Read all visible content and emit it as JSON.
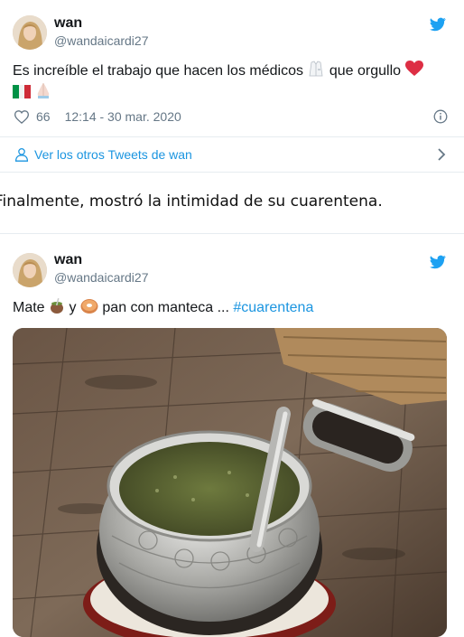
{
  "tweet1": {
    "name": "wan",
    "handle": "@wandaicardi27",
    "text": "Es increíble el trabajo que hacen los médicos",
    "text2": "que orgullo",
    "likes": "66",
    "timestamp": "12:14 - 30 mar. 2020",
    "more_link": "Ver los otros Tweets de wan"
  },
  "caption": "Finalmente, mostró la intimidad de su cuarentena.",
  "tweet2": {
    "name": "wan",
    "handle": "@wandaicardi27",
    "text_a": "Mate",
    "text_b": "y",
    "text_c": "pan con manteca ...",
    "hashtag": "#cuarentena"
  },
  "colors": {
    "twitter_blue": "#1da1f2",
    "link_blue": "#1b95e0",
    "heart_red": "#e0245e",
    "muted_gray": "#657786"
  },
  "icons": [
    "twitter-bird-icon",
    "heart-outline-icon",
    "info-icon",
    "user-icon",
    "chevron-right-icon",
    "lab-coat-emoji",
    "red-heart-emoji",
    "italy-flag-emoji",
    "praying-hands-emoji",
    "mate-emoji",
    "bagel-emoji"
  ]
}
